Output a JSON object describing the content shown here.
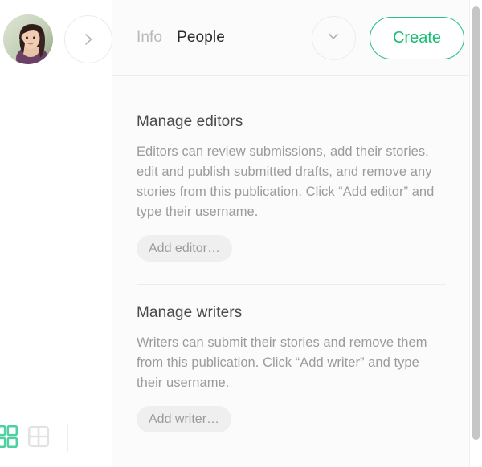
{
  "sidebar": {
    "avatar_alt": "user-avatar",
    "next_button_label": "",
    "bottom_toolbar": {
      "grid_view_active_label": "",
      "grid_view_label": ""
    }
  },
  "header": {
    "tabs": [
      {
        "label": "Info",
        "active": false
      },
      {
        "label": "People",
        "active": true
      }
    ],
    "dropdown_label": "",
    "create_label": "Create",
    "accent_color": "#18bd73",
    "create_border_color": "#23c282"
  },
  "content": {
    "sections": [
      {
        "title": "Manage editors",
        "body": "Editors can review submissions, add their stories, edit and publish submitted drafts, and remove any stories from this publication. Click “Add editor” and type their username.",
        "button_label": "Add editor…"
      },
      {
        "title": "Manage writers",
        "body": "Writers can submit their stories and remove them from this publication. Click “Add writer” and type their username.",
        "button_label": "Add writer…"
      }
    ]
  }
}
